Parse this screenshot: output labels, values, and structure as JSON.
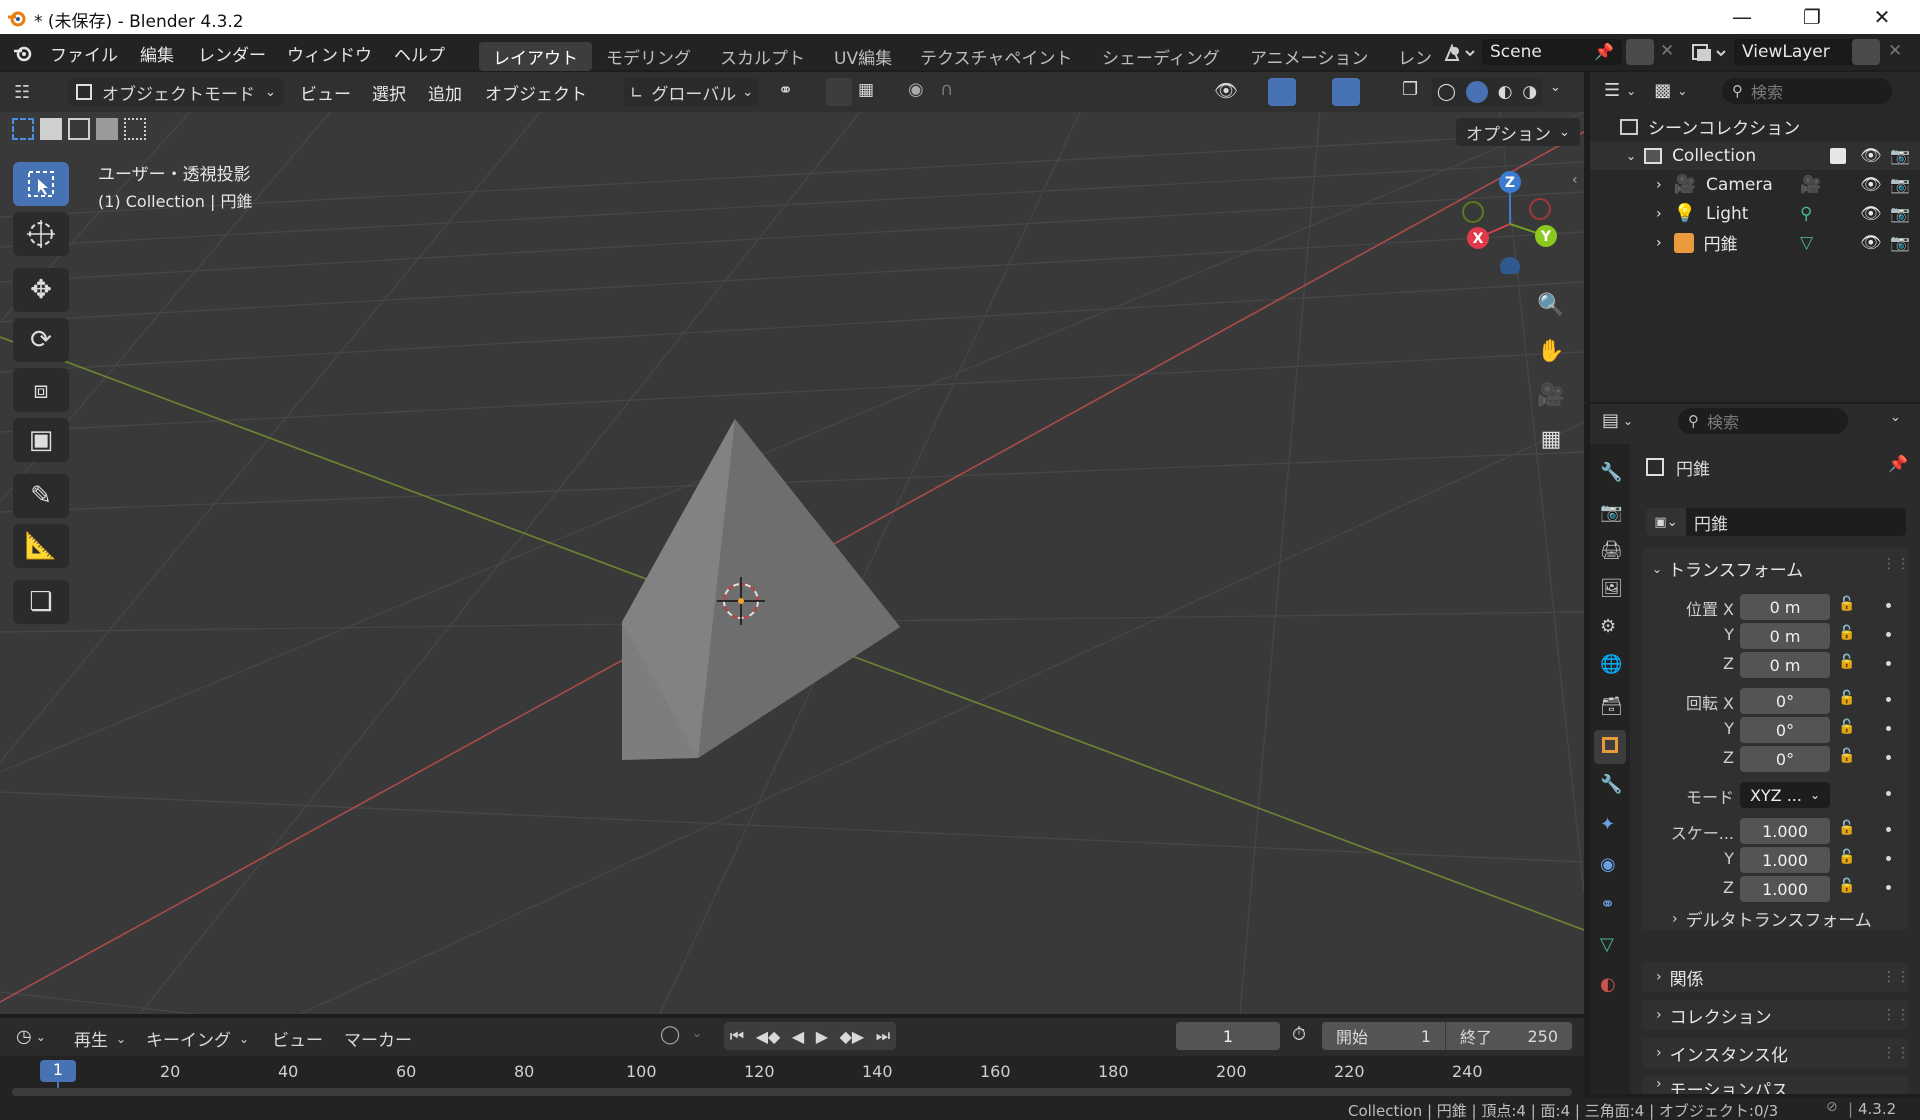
{
  "window": {
    "title": "* (未保存) - Blender 4.3.2"
  },
  "menu": {
    "items": [
      "ファイル",
      "編集",
      "レンダー",
      "ウィンドウ",
      "ヘルプ"
    ],
    "workspaces": [
      "レイアウト",
      "モデリング",
      "スカルプト",
      "UV編集",
      "テクスチャペイント",
      "シェーディング",
      "アニメーション",
      "レン"
    ],
    "active_workspace": "レイアウト",
    "scene": "Scene",
    "view_layer": "ViewLayer"
  },
  "viewport": {
    "mode": "オブジェクトモード",
    "menus": [
      "ビュー",
      "選択",
      "追加",
      "オブジェクト"
    ],
    "transform_orientation": "グローバル",
    "options_label": "オプション",
    "overlay_title": "ユーザー・透視投影",
    "overlay_subtitle": "(1) Collection | 円錐",
    "gizmo_axes": [
      "X",
      "Y",
      "Z"
    ]
  },
  "outliner": {
    "search_placeholder": "検索",
    "scene_collection": "シーンコレクション",
    "collection": "Collection",
    "objects": [
      {
        "name": "Camera"
      },
      {
        "name": "Light"
      },
      {
        "name": "円錐"
      }
    ]
  },
  "properties": {
    "search_placeholder": "検索",
    "object_name": "円錐",
    "data_name": "円錐",
    "transform_header": "トランスフォーム",
    "location_label": "位置 X",
    "location": [
      "0 m",
      "0 m",
      "0 m"
    ],
    "rotation_label": "回転 X",
    "rotation": [
      "0°",
      "0°",
      "0°"
    ],
    "mode_label": "モード",
    "mode_value": "XYZ ...",
    "scale_label": "スケー...",
    "scale": [
      "1.000",
      "1.000",
      "1.000"
    ],
    "axis_y": "Y",
    "axis_z": "Z",
    "delta_transform": "デルタトランスフォーム",
    "sections": [
      "関係",
      "コレクション",
      "インスタンス化",
      "モーションパス"
    ]
  },
  "timeline": {
    "menus": [
      "再生",
      "キーイング",
      "ビュー",
      "マーカー"
    ],
    "current_frame": "1",
    "start_label": "開始",
    "start": "1",
    "end_label": "終了",
    "end": "250",
    "ticks": [
      "1",
      "20",
      "40",
      "60",
      "80",
      "100",
      "120",
      "140",
      "160",
      "180",
      "200",
      "220",
      "240"
    ]
  },
  "status": {
    "text": "Collection | 円錐 | 頂点:4 | 面:4 | 三角面:4 | オブジェクト:0/3",
    "version": "4.3.2"
  }
}
